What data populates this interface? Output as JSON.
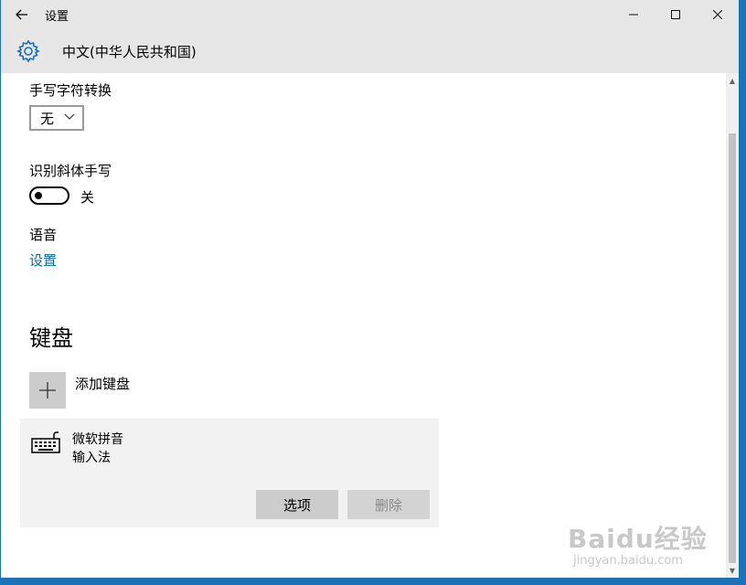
{
  "window": {
    "title": "设置",
    "controls": {
      "minimize": "—",
      "maximize": "☐",
      "close": "✕"
    }
  },
  "header": {
    "title": "中文(中华人民共和国)",
    "icon": "gear-icon"
  },
  "handwriting": {
    "conversion_label": "手写字符转换",
    "conversion_value": "无"
  },
  "italic": {
    "label": "识别斜体手写",
    "toggle_state": "关"
  },
  "speech": {
    "label": "语音",
    "link": "设置"
  },
  "keyboard": {
    "heading": "键盘",
    "add_label": "添加键盘",
    "ime": {
      "name": "微软拼音",
      "type": "输入法",
      "options_button": "选项",
      "delete_button": "删除"
    }
  },
  "watermark": {
    "main": "Baidu经验",
    "sub": "jingyan.baidu.com"
  },
  "colors": {
    "accent": "#1a6fb3",
    "link": "#0b6a9f",
    "chrome": "#e6e6e6",
    "border": "#1a73b9"
  }
}
